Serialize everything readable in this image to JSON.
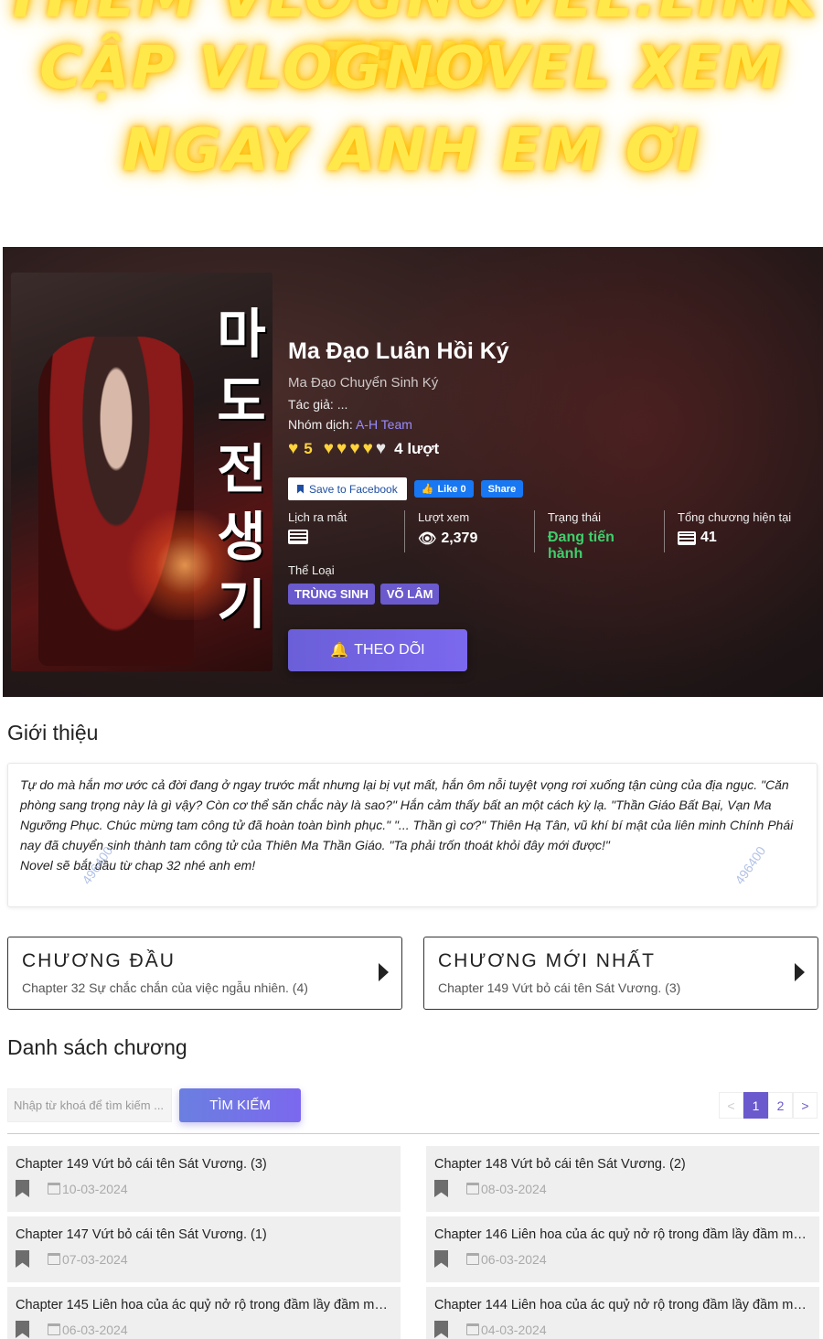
{
  "promo": {
    "line1": "THÊM VLOGNOVEL.LINK TRUY",
    "line2": "CẬP VLOGNOVEL XEM",
    "line3": "NGAY ANH EM ƠI"
  },
  "cover": {
    "title_text": "마도전생기"
  },
  "manga": {
    "title": "Ma Đạo Luân Hồi Ký",
    "alt_title": "Ma Đạo Chuyển Sinh Ký",
    "author_label": "Tác giả: ...",
    "group_prefix": "Nhóm dịch: ",
    "group_name": "A-H Team",
    "rating_score": "5",
    "rating_votes": "4 lượt",
    "save_fb": "Save to Facebook",
    "like": "Like 0",
    "share": "Share",
    "stats": {
      "release_label": "Lịch ra mắt",
      "views_label": "Lượt xem",
      "views_value": "2,379",
      "status_label": "Trạng thái",
      "status_value": "Đang tiến hành",
      "chapters_label": "Tổng chương hiện tại",
      "chapters_value": "41"
    },
    "genre_label": "Thể Loại",
    "genres": [
      "TRÙNG SINH",
      "VÕ LÂM"
    ],
    "follow": "THEO DÕI",
    "colors": {
      "accent": "#6a5acd",
      "status_green": "#3ecf6c",
      "heart": "#ffd43b"
    }
  },
  "intro": {
    "heading": "Giới thiệu",
    "text": "Tự do mà hắn mơ ước cả đời đang ở ngay trước mắt nhưng lại bị vụt mất, hắn ôm nỗi tuyệt vọng rơi xuống tận cùng của địa ngục. \"Căn phòng sang trọng này là gì vậy? Còn cơ thể săn chắc này là sao?\" Hắn cảm thấy bất an một cách kỳ lạ. \"Thần Giáo Bất Bại, Vạn Ma Ngưỡng Phục. Chúc mừng tam công tử đã hoàn toàn bình phục.\" \"... Thần gì cơ?\" Thiên Hạ Tân, vũ khí bí mật của liên minh Chính Phái nay đã chuyển sinh thành tam công tử của Thiên Ma Thần Giáo. \"Ta phải trốn thoát khỏi đây mới được!\"",
    "note": "Novel sẽ bắt đầu từ chap 32 nhé anh em!",
    "watermark": "496400"
  },
  "first_chapter": {
    "heading": "CHƯƠNG ĐẦU",
    "name": "Chapter 32 Sự chắc chắn của việc ngẫu nhiên. (4)"
  },
  "latest_chapter": {
    "heading": "CHƯƠNG MỚI NHẤT",
    "name": "Chapter 149 Vứt bỏ cái tên Sát Vương. (3)"
  },
  "chapter_list": {
    "heading": "Danh sách chương",
    "search_placeholder": "Nhập từ khoá để tìm kiếm ...",
    "search_button": "TÌM KIẾM",
    "pager": {
      "prev": "<",
      "pages": [
        "1",
        "2"
      ],
      "next": ">"
    },
    "items": [
      {
        "name": "Chapter 149 Vứt bỏ cái tên Sát Vương. (3)",
        "date": "10-03-2024"
      },
      {
        "name": "Chapter 148 Vứt bỏ cái tên Sát Vương. (2)",
        "date": "08-03-2024"
      },
      {
        "name": "Chapter 147 Vứt bỏ cái tên Sát Vương. (1)",
        "date": "07-03-2024"
      },
      {
        "name": "Chapter 146 Liên hoa của ác quỷ nở rộ trong đầm lầy đầm má...",
        "date": "06-03-2024"
      },
      {
        "name": "Chapter 145 Liên hoa của ác quỷ nở rộ trong đầm lầy đầm má...",
        "date": "06-03-2024"
      },
      {
        "name": "Chapter 144 Liên hoa của ác quỷ nở rộ trong đầm lầy đầm má...",
        "date": "04-03-2024"
      }
    ]
  }
}
